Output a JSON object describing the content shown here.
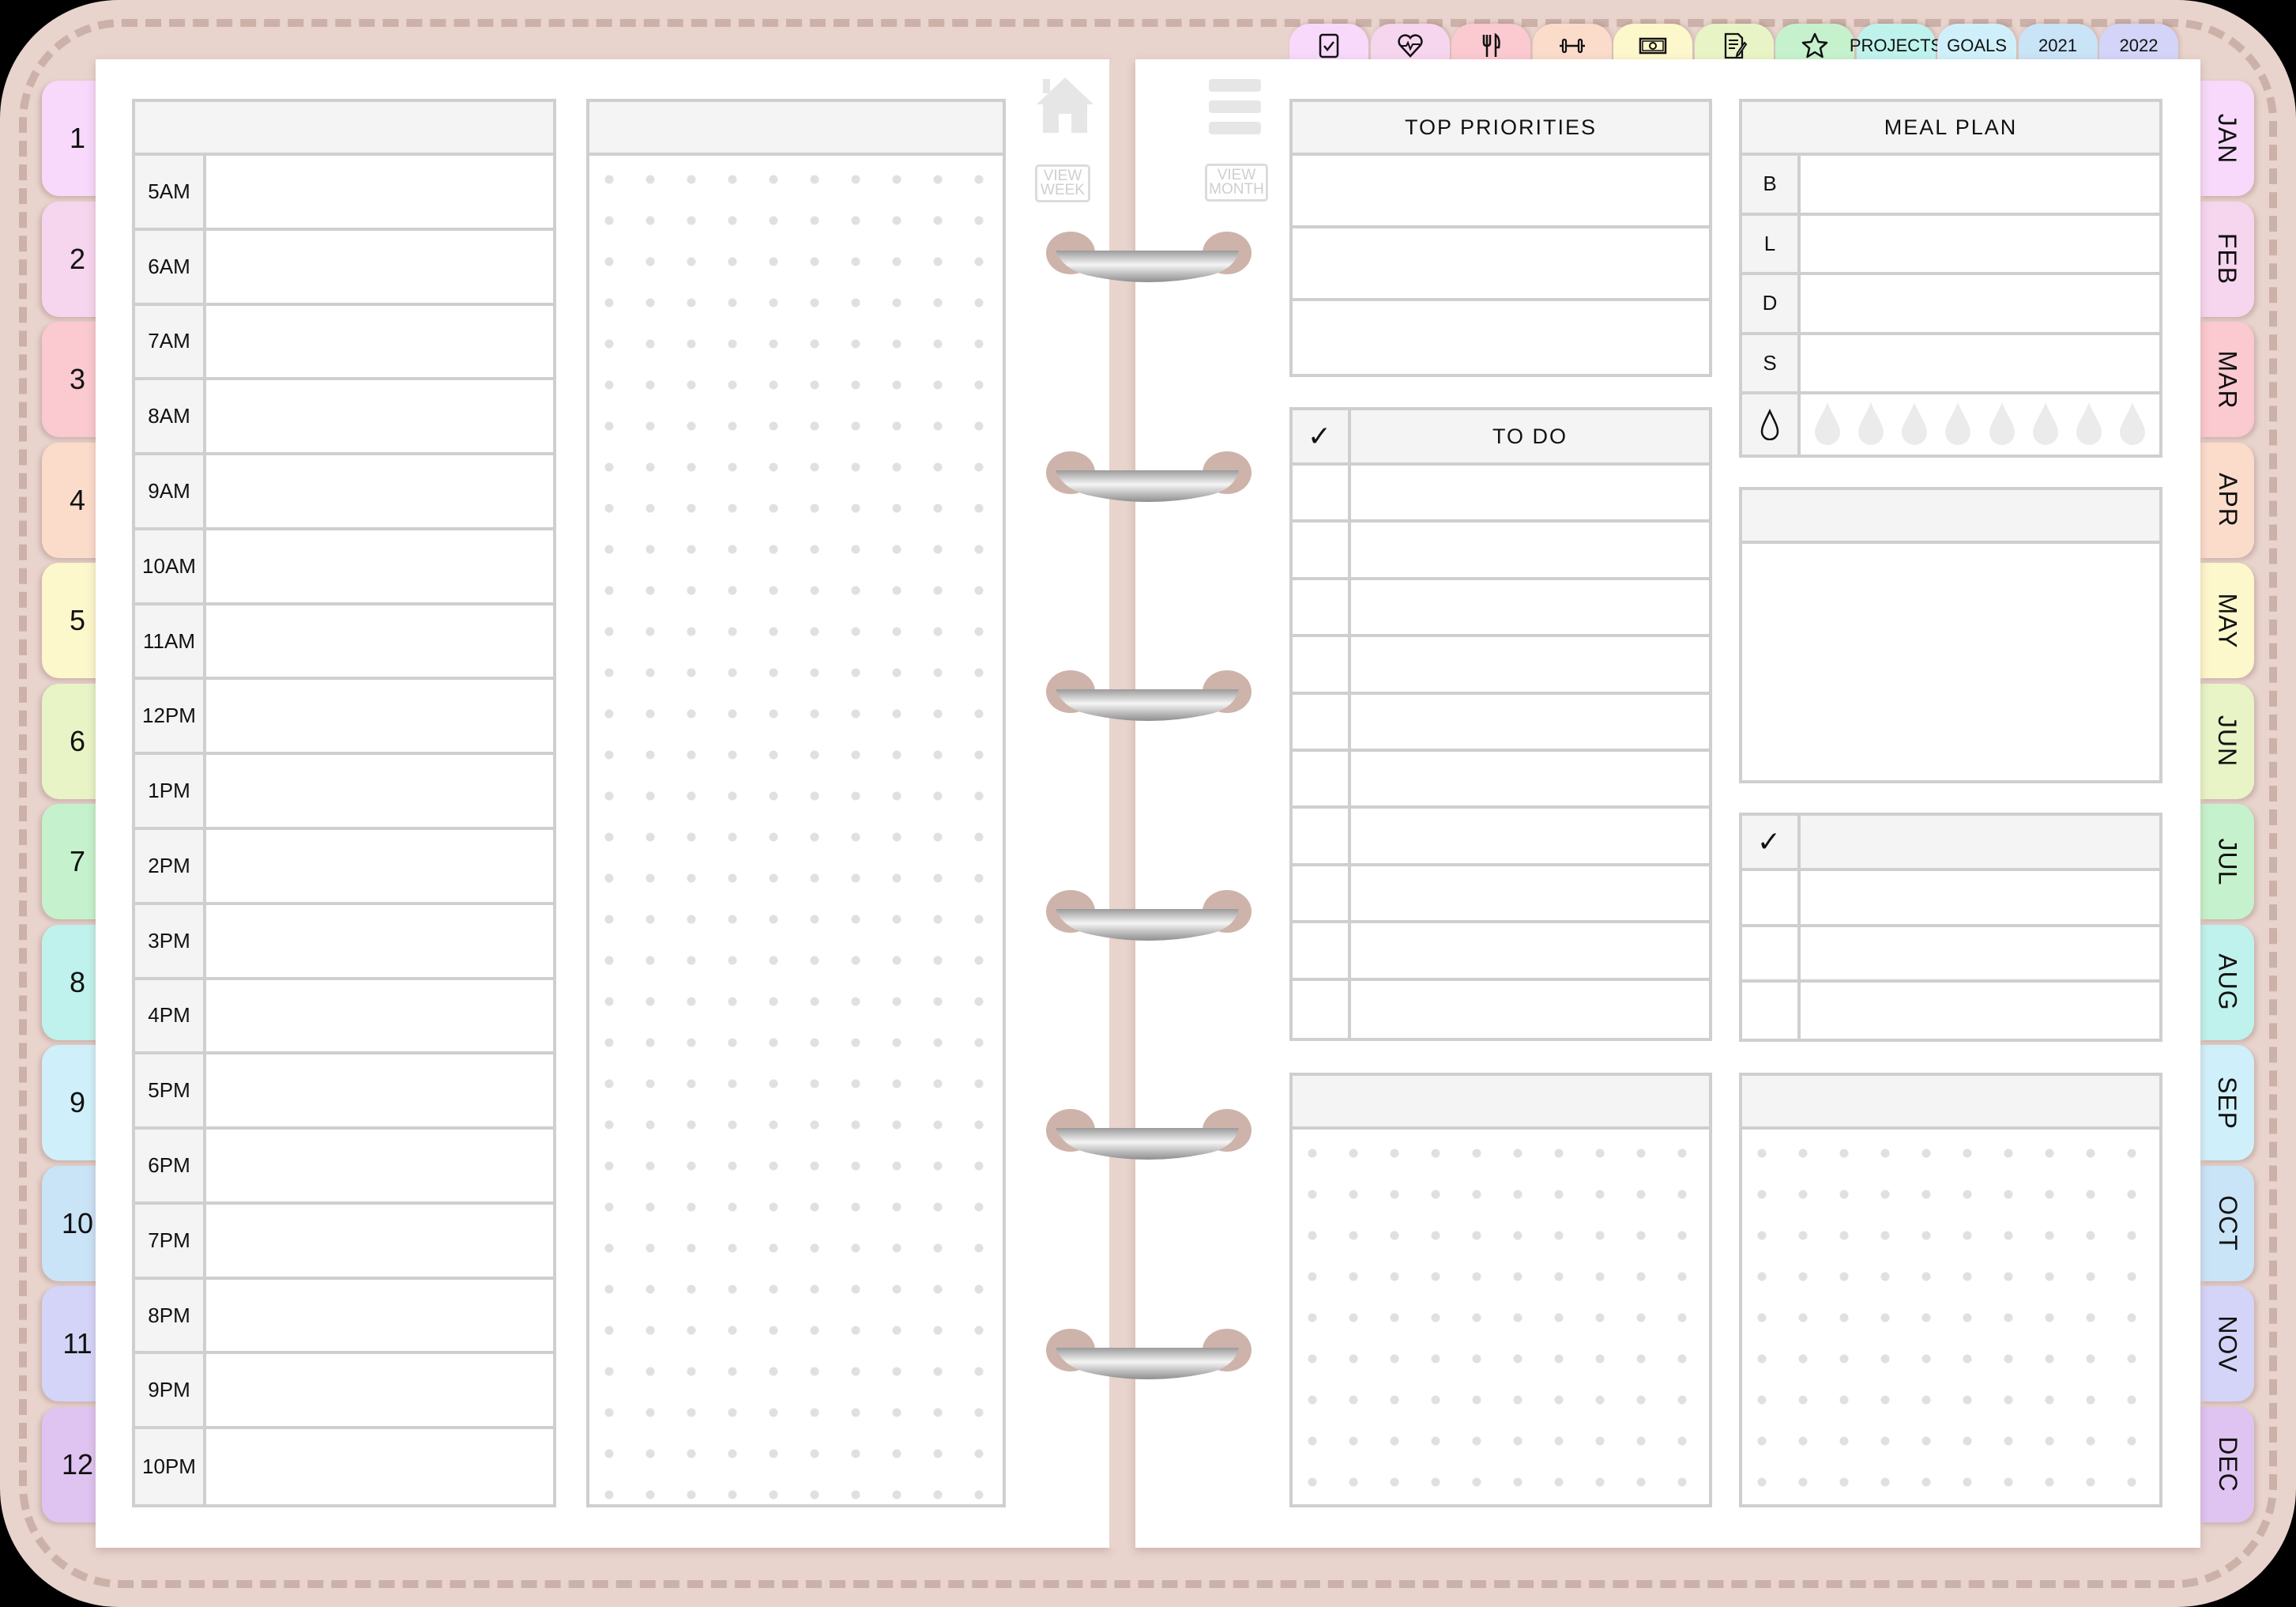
{
  "colors": {
    "cover": "#e8d3cd",
    "stitch": "#ccb1a9",
    "grid_line": "#cfcfcf",
    "header_fill": "#f4f4f4",
    "tab_colors": [
      "#f8d9fb",
      "#f6d5ee",
      "#fbc9d0",
      "#fbdccb",
      "#fdf7cc",
      "#e8f4c6",
      "#c5f2cc",
      "#bff2ec",
      "#cff0fa",
      "#c9e3f7",
      "#d4d4f8",
      "#dfc4f2"
    ]
  },
  "top_tabs": [
    {
      "icon": "checkbox-icon",
      "label": ""
    },
    {
      "icon": "heart-pulse-icon",
      "label": ""
    },
    {
      "icon": "fork-knife-icon",
      "label": ""
    },
    {
      "icon": "dumbbell-icon",
      "label": ""
    },
    {
      "icon": "money-icon",
      "label": ""
    },
    {
      "icon": "notes-pencil-icon",
      "label": ""
    },
    {
      "icon": "star-icon",
      "label": ""
    },
    {
      "icon": "",
      "label": "PROJECTS"
    },
    {
      "icon": "",
      "label": "GOALS"
    },
    {
      "icon": "",
      "label": "2021"
    },
    {
      "icon": "",
      "label": "2022"
    }
  ],
  "left_tabs": [
    "1",
    "2",
    "3",
    "4",
    "5",
    "6",
    "7",
    "8",
    "9",
    "10",
    "11",
    "12"
  ],
  "right_tabs": [
    "JAN",
    "FEB",
    "MAR",
    "APR",
    "MAY",
    "JUN",
    "JUL",
    "AUG",
    "SEP",
    "OCT",
    "NOV",
    "DEC"
  ],
  "navigation": {
    "home_icon": "home-icon",
    "menu_icon": "menu-icon",
    "view_week": [
      "VIEW",
      "WEEK"
    ],
    "view_month": [
      "VIEW",
      "MONTH"
    ]
  },
  "schedule": {
    "header": "",
    "times": [
      "5AM",
      "6AM",
      "7AM",
      "8AM",
      "9AM",
      "10AM",
      "11AM",
      "12PM",
      "1PM",
      "2PM",
      "3PM",
      "4PM",
      "5PM",
      "6PM",
      "7PM",
      "8PM",
      "9PM",
      "10PM"
    ]
  },
  "notes_left": {
    "header": ""
  },
  "top_priorities": {
    "title": "TOP PRIORITIES",
    "rows": 3
  },
  "todo": {
    "check_symbol": "✓",
    "title": "TO DO",
    "rows": 10
  },
  "meal_plan": {
    "title": "MEAL PLAN",
    "meals": [
      "B",
      "L",
      "D",
      "S"
    ],
    "water_icon": "water-drop-icon",
    "water_glasses": 8
  },
  "notes_right": {
    "header": ""
  },
  "checklist": {
    "check_symbol": "✓",
    "header": "",
    "rows": 3
  },
  "bottom_left_box": {
    "header": ""
  },
  "bottom_right_box": {
    "header": ""
  },
  "rings": 6
}
